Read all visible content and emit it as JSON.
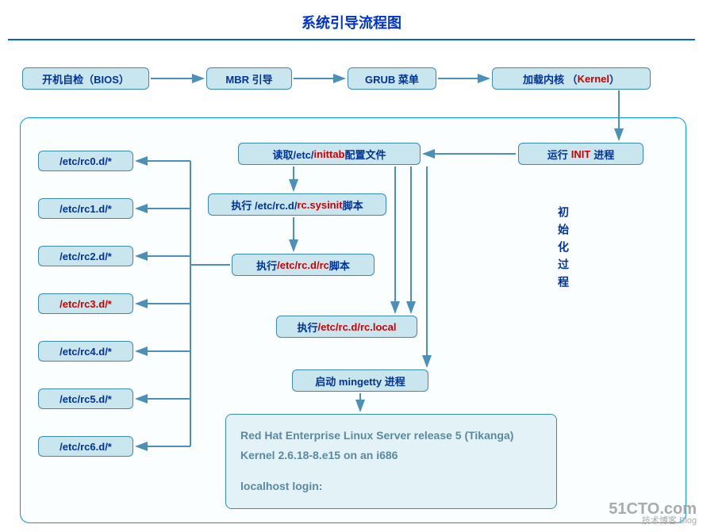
{
  "title": "系统引导流程图",
  "top_row": {
    "bios": "开机自检（BIOS）",
    "mbr": "MBR 引导",
    "grub": "GRUB 菜单",
    "kernel_pre": "加载内核 （",
    "kernel_red": "Kernel",
    "kernel_post": "）"
  },
  "init_box": {
    "pre": "运行 ",
    "red": "INIT",
    "post": " 进程"
  },
  "inittab": {
    "pre": "读取/etc/",
    "red": "inittab",
    "post": "配置文件"
  },
  "sysinit": {
    "pre": "执行 /etc/rc.d/",
    "red": "rc.sysinit",
    "post": " 脚本"
  },
  "rc_script": {
    "pre": "执行 ",
    "red": "/etc/rc.d/rc",
    "post": " 脚本"
  },
  "rc_local": {
    "pre": "执行",
    "red": "/etc/rc.d/rc.local",
    "post": ""
  },
  "mingetty": "启动 mingetty 进程",
  "rc_items": [
    {
      "label": "/etc/rc0.d/*",
      "red": false
    },
    {
      "label": "/etc/rc1.d/*",
      "red": false
    },
    {
      "label": "/etc/rc2.d/*",
      "red": false
    },
    {
      "label": "/etc/rc3.d/*",
      "red": true
    },
    {
      "label": "/etc/rc4.d/*",
      "red": false
    },
    {
      "label": "/etc/rc5.d/*",
      "red": false
    },
    {
      "label": "/etc/rc6.d/*",
      "red": false
    }
  ],
  "login_box": {
    "line1": "Red Hat Enterprise Linux Server release 5 (Tikanga)",
    "line2": "Kernel  2.6.18-8.e15 on an i686",
    "line3": "localhost  login:"
  },
  "init_process_label": "初始化过程",
  "watermark": {
    "main": "51CTO.com",
    "sub": "技术博客  Blog"
  }
}
